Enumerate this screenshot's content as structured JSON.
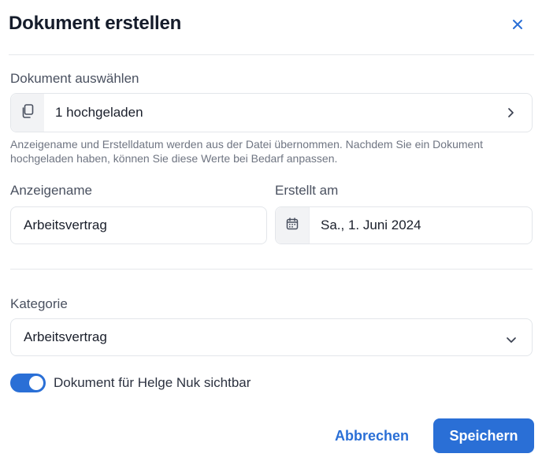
{
  "dialog": {
    "title": "Dokument erstellen"
  },
  "document_select": {
    "label": "Dokument auswählen",
    "value": "1 hochgeladen",
    "icon": "copy-icon",
    "chevron_icon": "chevron-right-icon"
  },
  "hint": "Anzeigename und Erstelldatum werden aus der Datei übernommen. Nachdem Sie ein Dokument hochgeladen haben, können Sie diese Werte bei Bedarf anpassen.",
  "display_name": {
    "label": "Anzeigename",
    "value": "Arbeitsvertrag"
  },
  "created_at": {
    "label": "Erstellt am",
    "value": "Sa., 1. Juni 2024",
    "icon": "calendar-icon"
  },
  "category": {
    "label": "Kategorie",
    "value": "Arbeitsvertrag",
    "chevron_icon": "chevron-down-icon"
  },
  "visibility": {
    "label": "Dokument für Helge Nuk sichtbar",
    "on": true
  },
  "actions": {
    "cancel_label": "Abbrechen",
    "save_label": "Speichern"
  },
  "colors": {
    "accent": "#2a6fd6",
    "title": "#151c2b",
    "muted": "#6f7582",
    "border": "#e3e6ea"
  }
}
